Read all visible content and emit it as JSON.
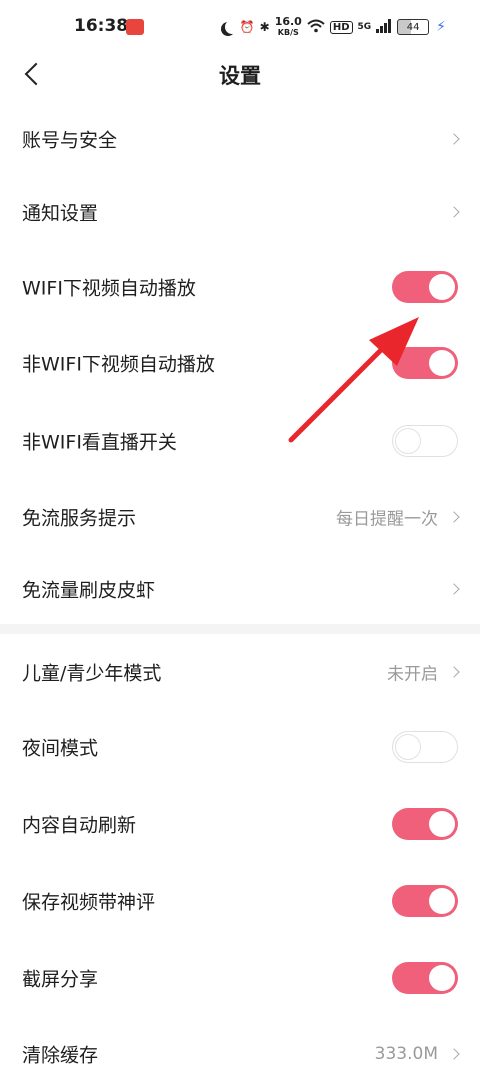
{
  "status_bar": {
    "time": "16:38",
    "net_speed_top": "16.0",
    "net_speed_unit": "KB/S",
    "hd": "HD",
    "signal": "5G",
    "battery": "44",
    "icons": [
      "moon-icon",
      "alarm-icon",
      "bluetooth-icon",
      "wifi-icon",
      "signal-icon",
      "battery-icon",
      "charging-icon"
    ]
  },
  "header": {
    "title": "设置"
  },
  "settings": {
    "account": {
      "label": "账号与安全"
    },
    "notify": {
      "label": "通知设置"
    },
    "wifi_autoplay": {
      "label": "WIFI下视频自动播放",
      "on": true
    },
    "nonwifi_autoplay": {
      "label": "非WIFI下视频自动播放",
      "on": true
    },
    "nonwifi_live": {
      "label": "非WIFI看直播开关",
      "on": false
    },
    "free_data_tip": {
      "label": "免流服务提示",
      "value": "每日提醒一次"
    },
    "free_data_shrimp": {
      "label": "免流量刷皮皮虾"
    },
    "kids_mode": {
      "label": "儿童/青少年模式",
      "value": "未开启"
    },
    "night_mode": {
      "label": "夜间模式",
      "on": false
    },
    "auto_refresh": {
      "label": "内容自动刷新",
      "on": true
    },
    "save_with_comment": {
      "label": "保存视频带神评",
      "on": true
    },
    "screenshot_share": {
      "label": "截屏分享",
      "on": true
    },
    "clear_cache": {
      "label": "清除缓存",
      "value": "333.0M"
    }
  },
  "colors": {
    "toggle_on": "#f0607a",
    "annotation_arrow": "#e8262c",
    "secondary_text": "#9a9a9a"
  }
}
